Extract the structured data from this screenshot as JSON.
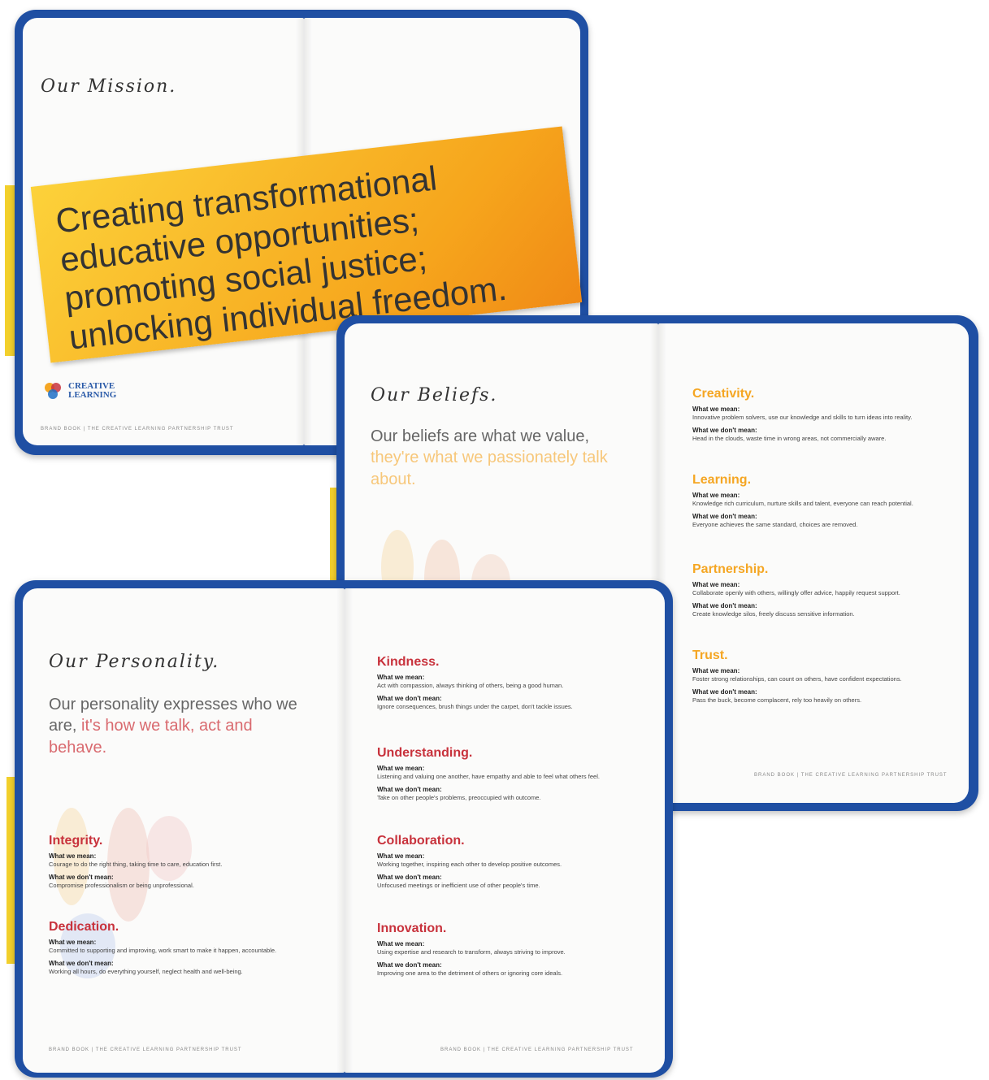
{
  "mission": {
    "heading": "Our Mission.",
    "statement_lines": [
      "Creating transformational",
      "educative opportunities;",
      "promoting social justice;",
      "unlocking individual freedom."
    ],
    "logo_text": "CREATIVE LEARNING",
    "footer": "BRAND BOOK | THE CREATIVE LEARNING PARTNERSHIP TRUST"
  },
  "beliefs": {
    "heading": "Our Beliefs.",
    "intro_plain": "Our beliefs are what we value,",
    "intro_accent": "they're what we passionately talk about.",
    "accent_color": "#f5a623",
    "sections": [
      {
        "title": "Creativity.",
        "mean_label": "What we mean:",
        "mean": "Innovative problem solvers, use our knowledge and skills to turn ideas into reality.",
        "dont_label": "What we don't mean:",
        "dont": "Head in the clouds, waste time in wrong areas, not commercially aware."
      },
      {
        "title": "Learning.",
        "mean_label": "What we mean:",
        "mean": "Knowledge rich curriculum, nurture skills and talent, everyone can reach potential.",
        "dont_label": "What we don't mean:",
        "dont": "Everyone achieves the same standard, choices are removed."
      },
      {
        "title": "Partnership.",
        "mean_label": "What we mean:",
        "mean": "Collaborate openly with others, willingly offer advice, happily request support.",
        "dont_label": "What we don't mean:",
        "dont": "Create knowledge silos, freely discuss sensitive information."
      },
      {
        "title": "Trust.",
        "mean_label": "What we mean:",
        "mean": "Foster strong relationships, can count on others, have confident expectations.",
        "dont_label": "What we don't mean:",
        "dont": "Pass the buck, become complacent, rely too heavily on others."
      }
    ],
    "footer": "BRAND BOOK | THE CREATIVE LEARNING PARTNERSHIP TRUST"
  },
  "personality": {
    "heading": "Our Personality.",
    "intro_plain": "Our personality expresses who we are,",
    "intro_accent": "it's how we talk, act and behave.",
    "accent_color": "#c8323c",
    "left_sections": [
      {
        "title": "Integrity.",
        "mean_label": "What we mean:",
        "mean": "Courage to do the right thing, taking time to care, education first.",
        "dont_label": "What we don't mean:",
        "dont": "Compromise professionalism or being unprofessional."
      },
      {
        "title": "Dedication.",
        "mean_label": "What we mean:",
        "mean": "Committed to supporting and improving, work smart to make it happen, accountable.",
        "dont_label": "What we don't mean:",
        "dont": "Working all hours, do everything yourself, neglect health and well-being."
      }
    ],
    "right_sections": [
      {
        "title": "Kindness.",
        "mean_label": "What we mean:",
        "mean": "Act with compassion, always thinking of others, being a good human.",
        "dont_label": "What we don't mean:",
        "dont": "Ignore consequences, brush things under the carpet, don't tackle issues."
      },
      {
        "title": "Understanding.",
        "mean_label": "What we mean:",
        "mean": "Listening and valuing one another, have empathy and able to feel what others feel.",
        "dont_label": "What we don't mean:",
        "dont": "Take on other people's problems, preoccupied with outcome."
      },
      {
        "title": "Collaboration.",
        "mean_label": "What we mean:",
        "mean": "Working together, inspiring each other to develop positive outcomes.",
        "dont_label": "What we don't mean:",
        "dont": "Unfocused meetings or inefficient use of other people's time."
      },
      {
        "title": "Innovation.",
        "mean_label": "What we mean:",
        "mean": "Using expertise and research to transform, always striving to improve.",
        "dont_label": "What we don't mean:",
        "dont": "Improving one area to the detriment of others or ignoring core ideals."
      }
    ],
    "footer_left": "BRAND BOOK | THE CREATIVE LEARNING PARTNERSHIP TRUST",
    "footer_right": "BRAND BOOK | THE CREATIVE LEARNING PARTNERSHIP TRUST"
  },
  "colors": {
    "book_cover": "#1f4fa3",
    "sticky_note": "#f7b21e",
    "tab": "#f3d02c"
  }
}
